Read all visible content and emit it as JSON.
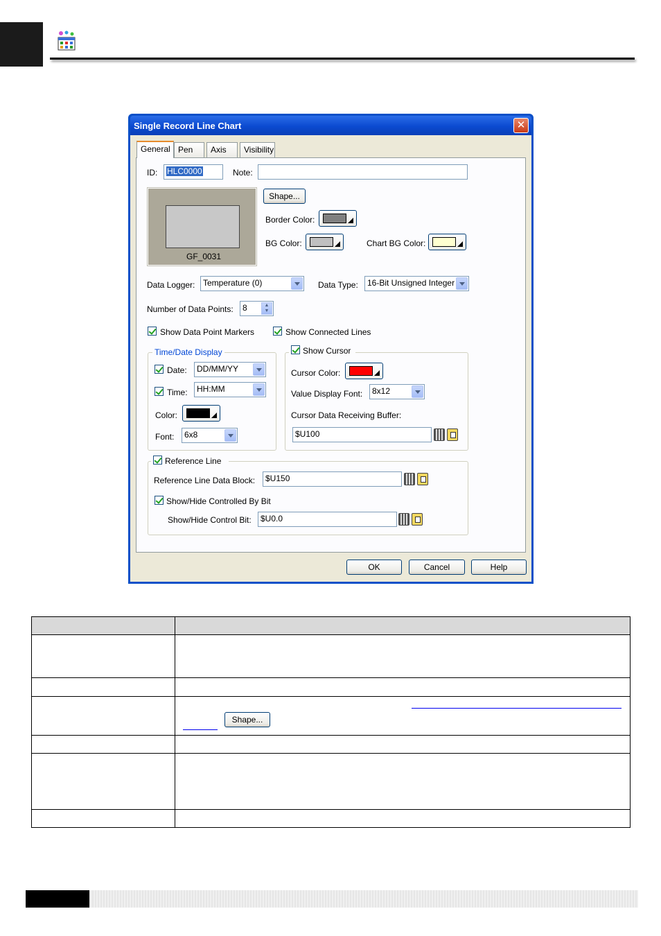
{
  "header": {
    "icon": "chart-tool-icon"
  },
  "dialog": {
    "title": "Single Record Line Chart",
    "close_icon": "close-icon",
    "tabs": [
      {
        "label": "General",
        "active": true
      },
      {
        "label": "Pen",
        "active": false
      },
      {
        "label": "Axis",
        "active": false
      },
      {
        "label": "Visibility",
        "active": false
      }
    ],
    "general": {
      "id_label": "ID:",
      "id_value": "HLC0000",
      "note_label": "Note:",
      "note_value": "",
      "preview_caption": "GF_0031",
      "shape_button": "Shape...",
      "border_color_label": "Border Color:",
      "border_color": "#808080",
      "bg_color_label": "BG Color:",
      "bg_color": "#c0c0c0",
      "chart_bg_color_label": "Chart BG Color:",
      "chart_bg_color": "#ffffd0",
      "data_logger_label": "Data Logger:",
      "data_logger_value": "Temperature (0)",
      "data_type_label": "Data Type:",
      "data_type_value": "16-Bit Unsigned Integer",
      "num_points_label": "Number of Data Points:",
      "num_points_value": "8",
      "show_markers_label": "Show Data Point Markers",
      "show_markers_checked": true,
      "show_lines_label": "Show Connected Lines",
      "show_lines_checked": true,
      "time_date": {
        "group_title": "Time/Date Display",
        "date_label": "Date:",
        "date_checked": true,
        "date_format": "DD/MM/YY",
        "time_label": "Time:",
        "time_checked": true,
        "time_format": "HH:MM",
        "color_label": "Color:",
        "color": "#000000",
        "font_label": "Font:",
        "font_value": "6x8"
      },
      "cursor": {
        "group_title": "Show Cursor",
        "checked": true,
        "color_label": "Cursor Color:",
        "color": "#ff0000",
        "value_font_label": "Value Display Font:",
        "value_font": "8x12",
        "buffer_label": "Cursor Data Receiving Buffer:",
        "buffer_value": "$U100"
      },
      "reference": {
        "group_title": "Reference Line",
        "checked": true,
        "data_block_label": "Reference Line Data Block:",
        "data_block_value": "$U150",
        "showhide_label": "Show/Hide Controlled By Bit",
        "showhide_checked": true,
        "control_bit_label": "Show/Hide Control Bit:",
        "control_bit_value": "$U0.0"
      }
    },
    "buttons": {
      "ok": "OK",
      "cancel": "Cancel",
      "help": "Help"
    }
  },
  "table": {
    "inline_shape_button": "Shape..."
  }
}
